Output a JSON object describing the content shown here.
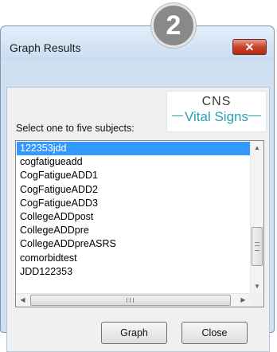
{
  "step_badge": "2",
  "window": {
    "title": "Graph Results",
    "close_glyph": "✕"
  },
  "logo": {
    "line1": "CNS",
    "line2": "Vital Signs"
  },
  "prompt": "Select one to five subjects:",
  "subjects": {
    "selected_index": 0,
    "items": [
      "122353jdd",
      "cogfatigueadd",
      "CogFatigueADD1",
      "CogFatigueADD2",
      "CogFatigueADD3",
      "CollegeADDpost",
      "CollegeADDpre",
      "CollegeADDpreASRS",
      "comorbidtest",
      "JDD122353"
    ]
  },
  "scroll_glyphs": {
    "up": "▲",
    "down": "▼",
    "left": "◀",
    "right": "▶"
  },
  "buttons": {
    "graph": "Graph",
    "close": "Close"
  },
  "colors": {
    "selection": "#3399ff",
    "logo_accent": "#2a9fb6",
    "close_button": "#c8432a"
  }
}
